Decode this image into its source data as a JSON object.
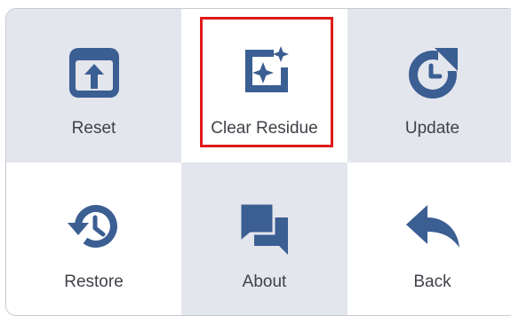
{
  "menu": {
    "items": [
      {
        "label": "Reset",
        "icon": "reset-icon"
      },
      {
        "label": "Clear Residue",
        "icon": "clear-residue-icon"
      },
      {
        "label": "Update",
        "icon": "update-icon"
      },
      {
        "label": "Restore",
        "icon": "restore-icon"
      },
      {
        "label": "About",
        "icon": "about-icon"
      },
      {
        "label": "Back",
        "icon": "back-icon"
      }
    ],
    "selected_index": 1
  },
  "colors": {
    "icon": "#3b5e93",
    "tile_gray": "#e4e6ed",
    "tile_white": "#ffffff",
    "selection": "#e01a1a",
    "label": "#3f4248"
  }
}
